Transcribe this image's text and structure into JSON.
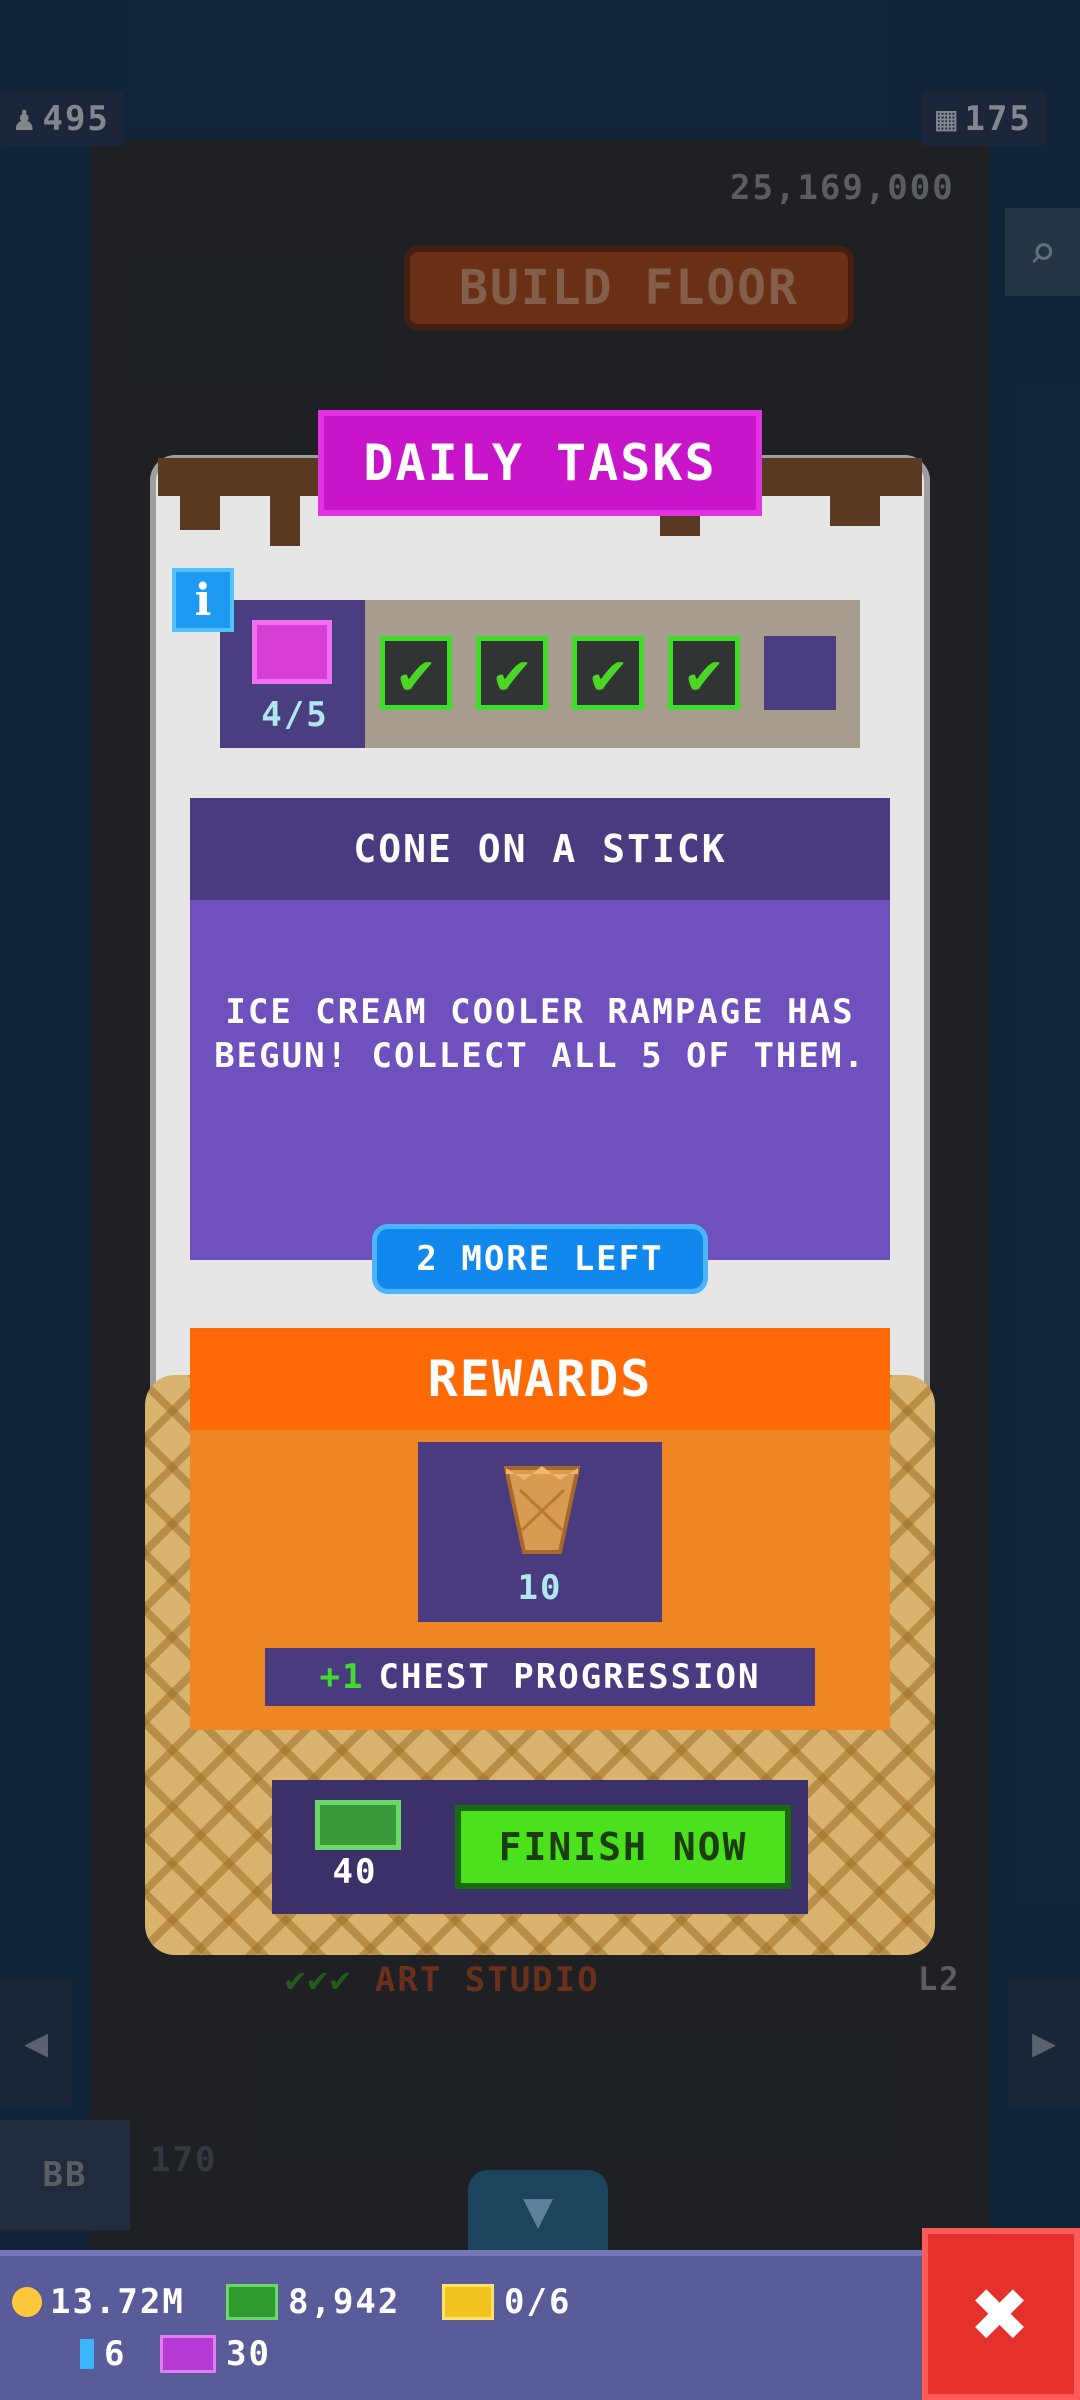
{
  "hud_top": {
    "population": "495",
    "population_icon": "person-icon",
    "floors": "175",
    "floors_icon": "building-icon",
    "tower_value": "25,169,000",
    "build_floor_label": "BUILD FLOOR"
  },
  "modal": {
    "title": "DAILY TASKS",
    "info_label": "i",
    "progress": {
      "count": "4/5",
      "completed": 4,
      "total": 5,
      "check_glyph": "✔"
    },
    "task": {
      "title": "CONE ON A STICK",
      "description": "ICE CREAM COOLER RAMPAGE HAS BEGUN! COLLECT ALL 5 OF THEM.",
      "remaining": "2 MORE LEFT"
    },
    "rewards": {
      "title": "REWARDS",
      "item_icon": "ice-cream-cone-icon",
      "item_count": "10",
      "chest_plus": "+1",
      "chest_label": "CHEST PROGRESSION"
    },
    "finish": {
      "cost": "40",
      "cost_icon": "tower-bux-icon",
      "button_label": "FINISH NOW"
    }
  },
  "scene": {
    "floor_name": "ART STUDIO",
    "floor_level": "L2",
    "floor_number": "170",
    "bb_label": "BB"
  },
  "hud_bottom": {
    "coins": "13.72M",
    "bux": "8,942",
    "tickets": "0/6",
    "gems": "6",
    "vip": "30",
    "close_glyph": "✖"
  },
  "colors": {
    "title_magenta": "#c915c9",
    "task_purple": "#6f51bd",
    "rewards_orange": "#ff6a06",
    "finish_green": "#4be21d",
    "close_red": "#e6302c"
  }
}
